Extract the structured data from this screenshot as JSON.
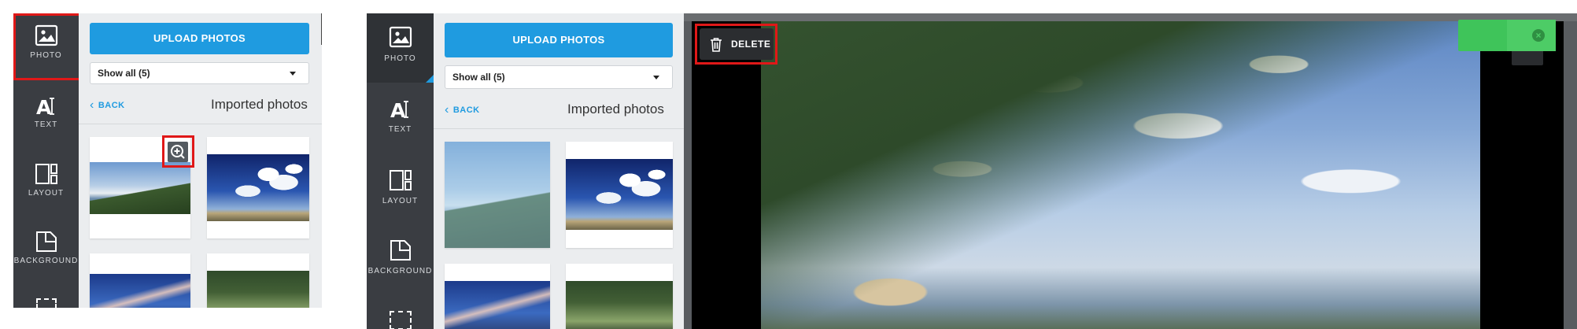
{
  "left_panel": {
    "rail": [
      {
        "label": "PHOTO",
        "icon": "image-icon"
      },
      {
        "label": "TEXT",
        "icon": "text-icon"
      },
      {
        "label": "LAYOUT",
        "icon": "layout-icon"
      },
      {
        "label": "BACKGROUND",
        "icon": "background-icon"
      }
    ],
    "upload_label": "UPLOAD PHOTOS",
    "filter_value": "Show all (5)",
    "back_label": "BACK",
    "heading": "Imported photos"
  },
  "right_panel": {
    "rail": [
      {
        "label": "PHOTO",
        "icon": "image-icon"
      },
      {
        "label": "TEXT",
        "icon": "text-icon"
      },
      {
        "label": "LAYOUT",
        "icon": "layout-icon"
      },
      {
        "label": "BACKGROUND",
        "icon": "background-icon"
      }
    ],
    "upload_label": "UPLOAD PHOTOS",
    "filter_value": "Show all (5)",
    "back_label": "BACK",
    "heading": "Imported photos",
    "delete_label": "DELETE"
  },
  "colors": {
    "accent": "#1f9be0",
    "highlight": "#e01818",
    "rail": "#3a3d42",
    "toast": "#3fc45a"
  }
}
